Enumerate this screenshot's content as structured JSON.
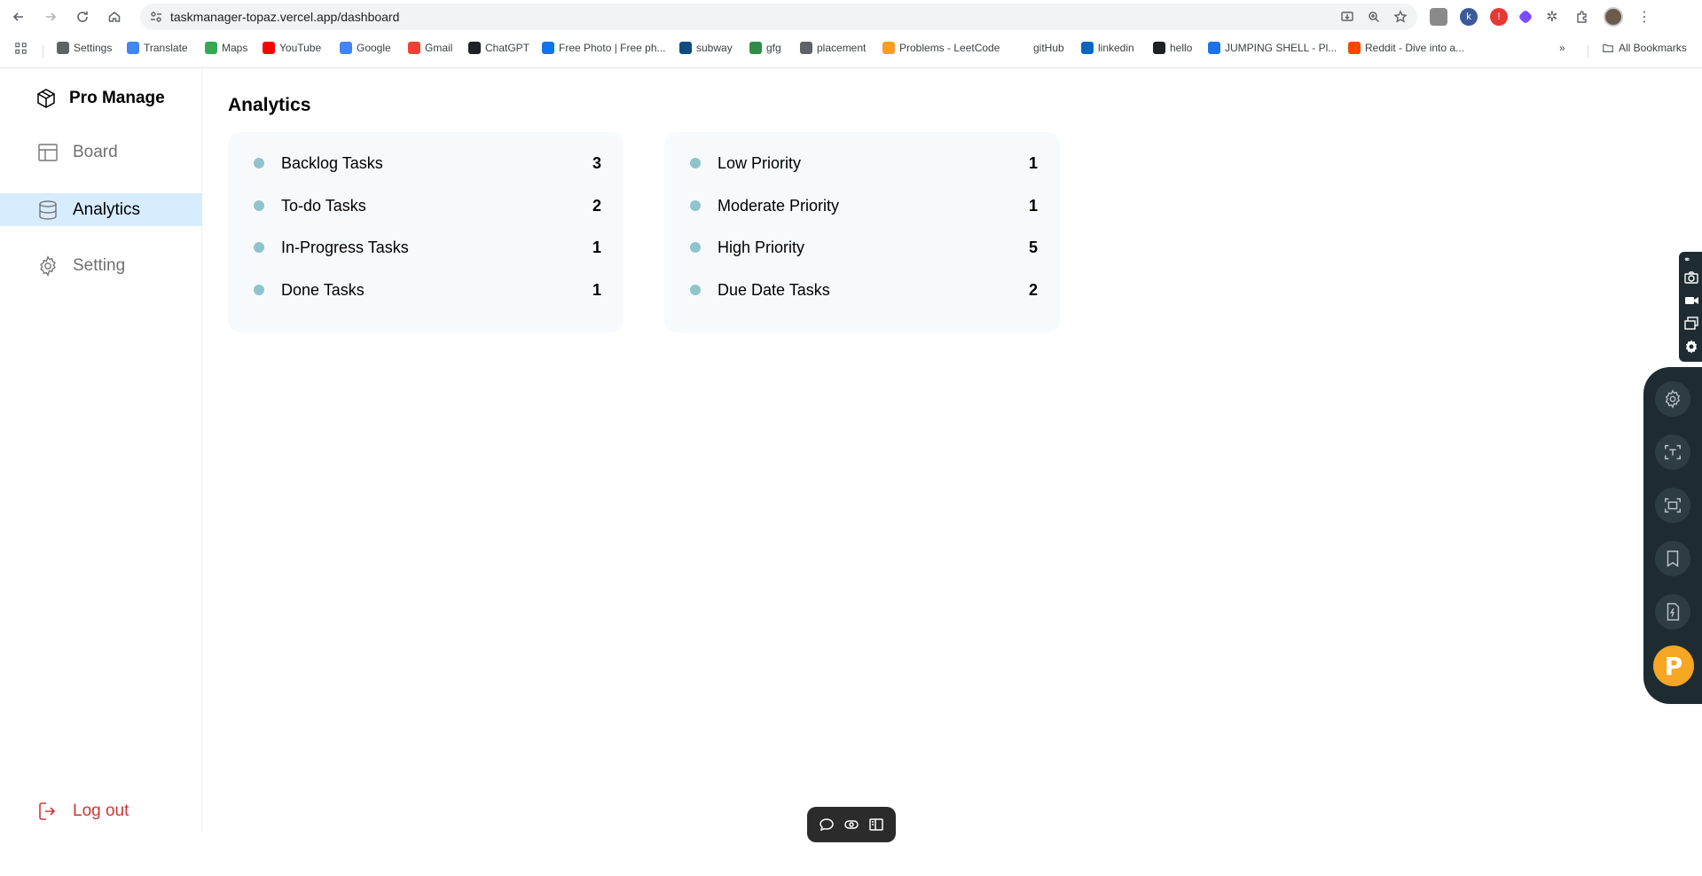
{
  "browser": {
    "url": "taskmanager-topaz.vercel.app/dashboard",
    "bookmarks": [
      {
        "label": "Settings",
        "icon": "gear-icon",
        "color": "#5f6368"
      },
      {
        "label": "Translate",
        "icon": "translate-icon",
        "color": "#4285f4"
      },
      {
        "label": "Maps",
        "icon": "maps-pin-icon",
        "color": "#34a853"
      },
      {
        "label": "YouTube",
        "icon": "youtube-icon",
        "color": "#ff0000"
      },
      {
        "label": "Google",
        "icon": "google-icon",
        "color": "#4285f4"
      },
      {
        "label": "Gmail",
        "icon": "gmail-icon",
        "color": "#ea4335"
      },
      {
        "label": "ChatGPT",
        "icon": "chatgpt-icon",
        "color": "#202124"
      },
      {
        "label": "Free Photo | Free ph...",
        "icon": "freepik-icon",
        "color": "#1273eb"
      },
      {
        "label": "subway",
        "icon": "subway-icon",
        "color": "#0f4c81"
      },
      {
        "label": "gfg",
        "icon": "gfg-icon",
        "color": "#2f8d46"
      },
      {
        "label": "placement",
        "icon": "globe-icon",
        "color": "#5f6368"
      },
      {
        "label": "Problems - LeetCode",
        "icon": "leetcode-icon",
        "color": "#f89f1b"
      },
      {
        "label": "gitHub",
        "icon": "",
        "color": ""
      },
      {
        "label": "linkedin",
        "icon": "linkedin-icon",
        "color": "#0a66c2"
      },
      {
        "label": "hello",
        "icon": "hello-icon",
        "color": "#202124"
      },
      {
        "label": "JUMPING SHELL - Pl...",
        "icon": "jumping-shell-icon",
        "color": "#1a73e8"
      },
      {
        "label": "Reddit - Dive into a...",
        "icon": "reddit-icon",
        "color": "#ff4500"
      }
    ],
    "all_bookmarks_label": "All Bookmarks"
  },
  "sidebar": {
    "brand": "Pro Manage",
    "items": [
      {
        "label": "Board",
        "icon": "board-layout-icon",
        "active": false
      },
      {
        "label": "Analytics",
        "icon": "database-icon",
        "active": true
      },
      {
        "label": "Setting",
        "icon": "gear-icon",
        "active": false
      }
    ],
    "logout_label": "Log out"
  },
  "main": {
    "title": "Analytics",
    "status_card": [
      {
        "label": "Backlog Tasks",
        "value": "3"
      },
      {
        "label": "To-do Tasks",
        "value": "2"
      },
      {
        "label": "In-Progress Tasks",
        "value": "1"
      },
      {
        "label": "Done Tasks",
        "value": "1"
      }
    ],
    "priority_card": [
      {
        "label": "Low Priority",
        "value": "1"
      },
      {
        "label": "Moderate Priority",
        "value": "1"
      },
      {
        "label": "High Priority",
        "value": "5"
      },
      {
        "label": "Due Date Tasks",
        "value": "2"
      }
    ]
  },
  "colors": {
    "accent": "#d7ecff",
    "dot": "#90c4cc",
    "card_bg": "#f6fafd",
    "logout": "#cf3636"
  }
}
